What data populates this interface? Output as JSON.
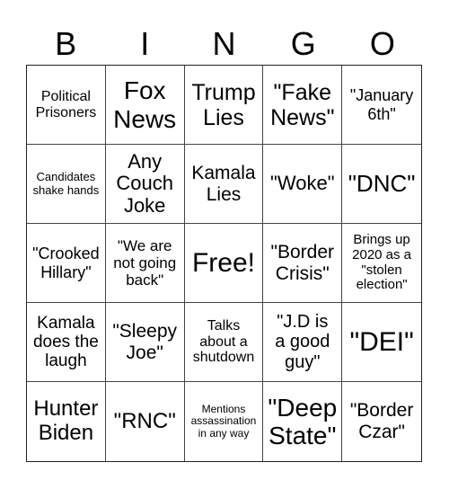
{
  "card": {
    "header": [
      "B",
      "I",
      "N",
      "G",
      "O"
    ],
    "cells": [
      {
        "text": "Political Prisoners"
      },
      {
        "text": "Fox News"
      },
      {
        "text": "Trump Lies"
      },
      {
        "text": "\"Fake News\""
      },
      {
        "text": "\"January 6th\""
      },
      {
        "text": "Candidates shake hands"
      },
      {
        "text": "Any Couch Joke"
      },
      {
        "text": "Kamala Lies"
      },
      {
        "text": "\"Woke\""
      },
      {
        "text": "\"DNC\""
      },
      {
        "text": "\"Crooked Hillary\""
      },
      {
        "text": "\"We are not going back\""
      },
      {
        "text": "Free!",
        "free": true
      },
      {
        "text": "\"Border Crisis\""
      },
      {
        "text": "Brings up 2020 as a \"stolen election\""
      },
      {
        "text": "Kamala does the laugh"
      },
      {
        "text": "\"Sleepy Joe\""
      },
      {
        "text": "Talks about a shutdown"
      },
      {
        "text": "\"J.D is a good guy\""
      },
      {
        "text": "\"DEI\""
      },
      {
        "text": "Hunter Biden"
      },
      {
        "text": "\"RNC\""
      },
      {
        "text": "Mentions assassination in any way"
      },
      {
        "text": "\"Deep State\""
      },
      {
        "text": "\"Border Czar\""
      }
    ]
  }
}
